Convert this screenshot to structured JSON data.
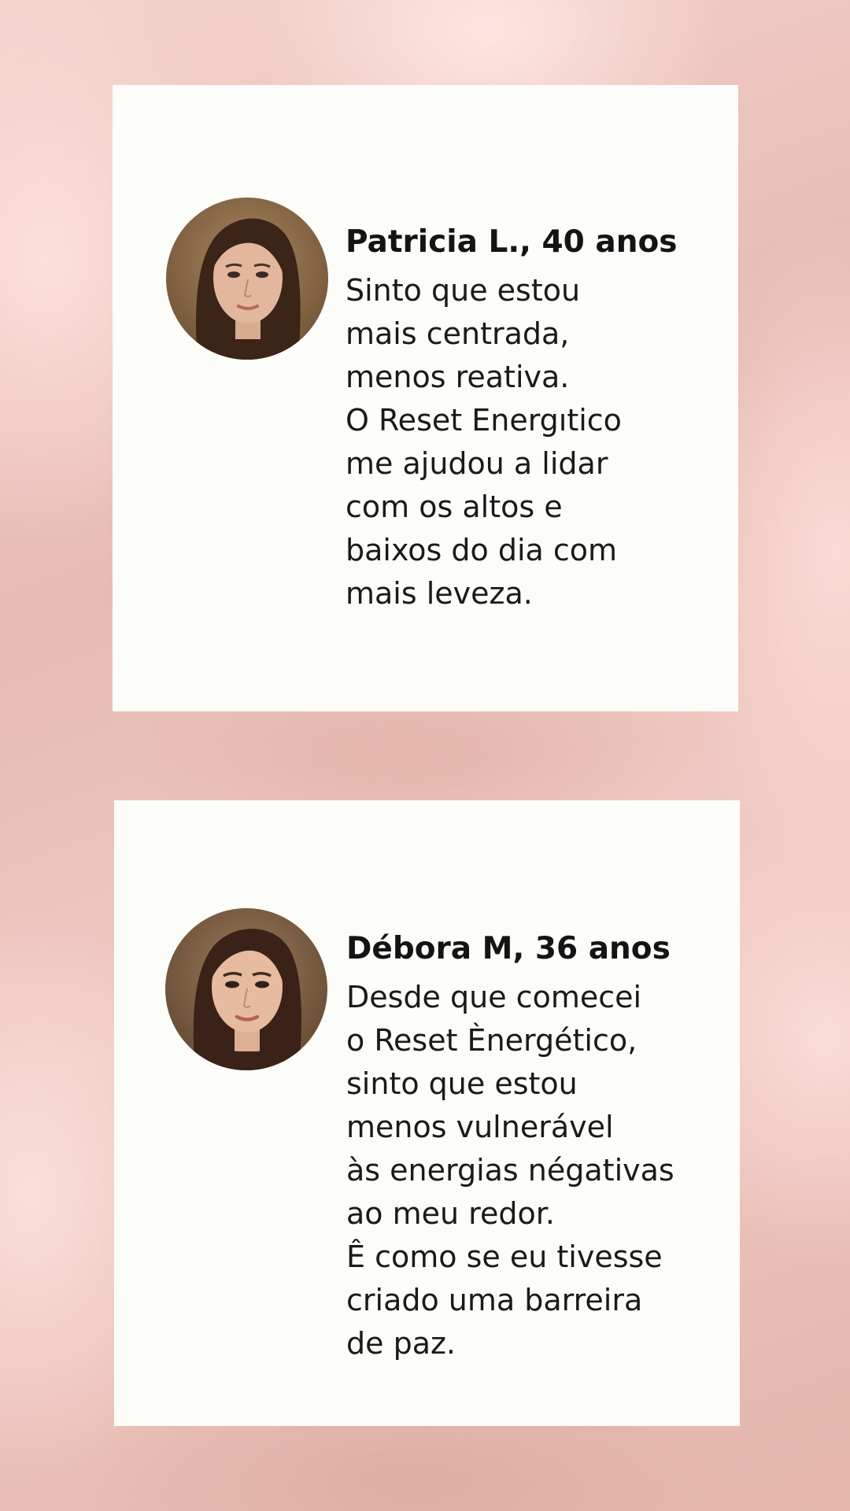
{
  "theme": {
    "background": "#eac4bc",
    "card": "#fcfcf8",
    "text": "#1a1a1a"
  },
  "testimonials": [
    {
      "avatar_icon": "woman-portrait-avatar",
      "name": "Patricia L., 40 anos",
      "lines": [
        "Sinto que estou",
        "mais centrada,",
        "menos reativa.",
        "O Reset Energıtico",
        "me ajudou a lidar",
        "com os altos e",
        "baixos do dia com",
        "mais leveza."
      ]
    },
    {
      "avatar_icon": "woman-portrait-avatar",
      "name": "Débora M, 36 anos",
      "lines": [
        "Desde que comecei",
        "o Reset Ènergético,",
        "sinto que estou",
        "menos vulnerável",
        "às energias négativas",
        "ao meu redor.",
        "Ê como se eu tivesse",
        "criado uma barreira",
        "de paz."
      ]
    }
  ]
}
